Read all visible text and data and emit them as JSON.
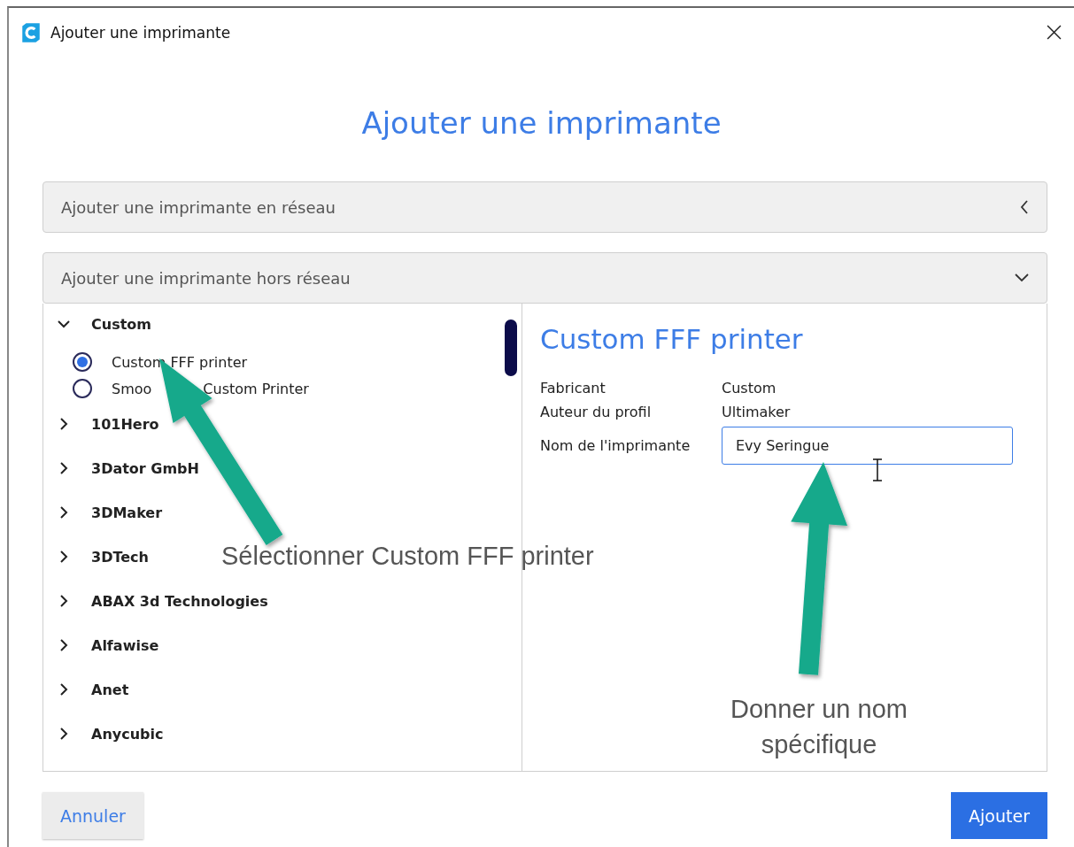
{
  "window": {
    "title": "Ajouter une imprimante"
  },
  "heading": "Ajouter une imprimante",
  "sections": [
    {
      "title": "Ajouter une imprimante en réseau",
      "expanded": false
    },
    {
      "title": "Ajouter une imprimante hors réseau",
      "expanded": true
    }
  ],
  "tree": [
    {
      "label": "Custom",
      "expanded": true,
      "children": [
        {
          "label_parts": [
            "Custom FFF printer"
          ],
          "selected": true
        },
        {
          "label_parts": [
            "Smoo",
            "Custom Printer"
          ],
          "selected": false
        }
      ]
    },
    {
      "label": "101Hero",
      "expanded": false
    },
    {
      "label": "3Dator GmbH",
      "expanded": false
    },
    {
      "label": "3DMaker",
      "expanded": false
    },
    {
      "label": "3DTech",
      "expanded": false
    },
    {
      "label": "ABAX 3d Technologies",
      "expanded": false
    },
    {
      "label": "Alfawise",
      "expanded": false
    },
    {
      "label": "Anet",
      "expanded": false
    },
    {
      "label": "Anycubic",
      "expanded": false
    }
  ],
  "details": {
    "title": "Custom FFF printer",
    "rows": [
      {
        "label": "Fabricant",
        "value": "Custom"
      },
      {
        "label": "Auteur du profil",
        "value": "Ultimaker"
      }
    ],
    "name_field": {
      "label": "Nom de l'imprimante",
      "value": "Evy Seringue"
    }
  },
  "annotations": [
    {
      "text": "Sélectionner Custom FFF printer"
    },
    {
      "text": "Donner un nom spécifique"
    }
  ],
  "buttons": [
    {
      "label": "Annuler",
      "kind": "secondary"
    },
    {
      "label": "Ajouter",
      "kind": "primary"
    }
  ]
}
